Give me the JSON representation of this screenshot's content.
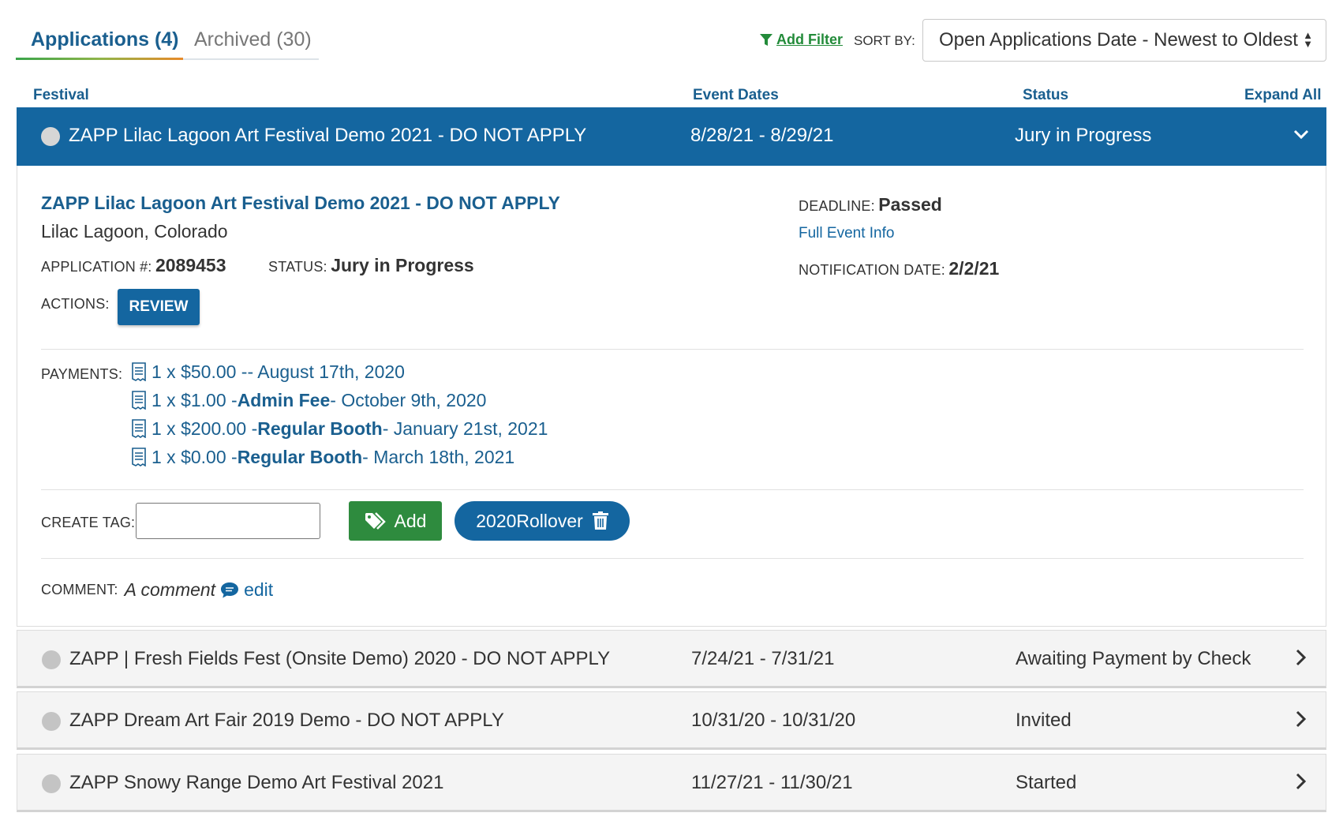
{
  "tabs": {
    "active": "Applications (4)",
    "archived": "Archived (30)"
  },
  "toolbar": {
    "add_filter": "Add Filter",
    "sort_label": "SORT BY:",
    "sort_value": "Open Applications Date - Newest to Oldest"
  },
  "columns": {
    "festival": "Festival",
    "event_dates": "Event Dates",
    "status": "Status",
    "expand_all": "Expand All"
  },
  "rows": [
    {
      "name": "ZAPP Lilac Lagoon Art Festival Demo 2021 - DO NOT APPLY",
      "dates": "8/28/21 - 8/29/21",
      "status": "Jury in Progress",
      "expanded": true
    },
    {
      "name": "ZAPP | Fresh Fields Fest (Onsite Demo) 2020 - DO NOT APPLY",
      "dates": "7/24/21 - 7/31/21",
      "status": "Awaiting Payment by Check",
      "expanded": false
    },
    {
      "name": "ZAPP Dream Art Fair 2019 Demo - DO NOT APPLY",
      "dates": "10/31/20 - 10/31/20",
      "status": "Invited",
      "expanded": false
    },
    {
      "name": "ZAPP Snowy Range Demo Art Festival 2021",
      "dates": "11/27/21 - 11/30/21",
      "status": "Started",
      "expanded": false
    }
  ],
  "detail": {
    "title": "ZAPP Lilac Lagoon Art Festival Demo 2021 - DO NOT APPLY",
    "location": "Lilac Lagoon, Colorado",
    "app_num_label": "APPLICATION #:",
    "app_num": "2089453",
    "status_label": "STATUS:",
    "status": "Jury in Progress",
    "deadline_label": "DEADLINE:",
    "deadline": "Passed",
    "event_info": "Full Event Info",
    "notif_label": "NOTIFICATION DATE:",
    "notif": "2/2/21",
    "actions_label": "ACTIONS:",
    "review": "REVIEW",
    "payments_label": "PAYMENTS:",
    "payments": [
      {
        "amount": "1 x $50.00 -",
        "item": "",
        "date": " - August 17th, 2020"
      },
      {
        "amount": "1 x $1.00 - ",
        "item": "Admin Fee",
        "date": " - October 9th, 2020"
      },
      {
        "amount": "1 x $200.00 - ",
        "item": "Regular Booth",
        "date": " - January 21st, 2021"
      },
      {
        "amount": "1 x $0.00 - ",
        "item": "Regular Booth",
        "date": " - March 18th, 2021"
      }
    ],
    "create_tag_label": "CREATE TAG:",
    "tag_input_value": "",
    "add_label": "Add",
    "tag": "2020Rollover",
    "comment_label": "COMMENT:",
    "comment": "A comment",
    "edit": "edit"
  },
  "colors": {
    "primary": "#1466a0",
    "green": "#2e8b3e",
    "row_bg": "#f4f4f4"
  },
  "icons": [
    "filter-icon",
    "sort-arrows-icon",
    "chevron-down-icon",
    "chevron-right-icon",
    "receipt-icon",
    "tag-icon",
    "trash-icon",
    "comment-icon"
  ]
}
